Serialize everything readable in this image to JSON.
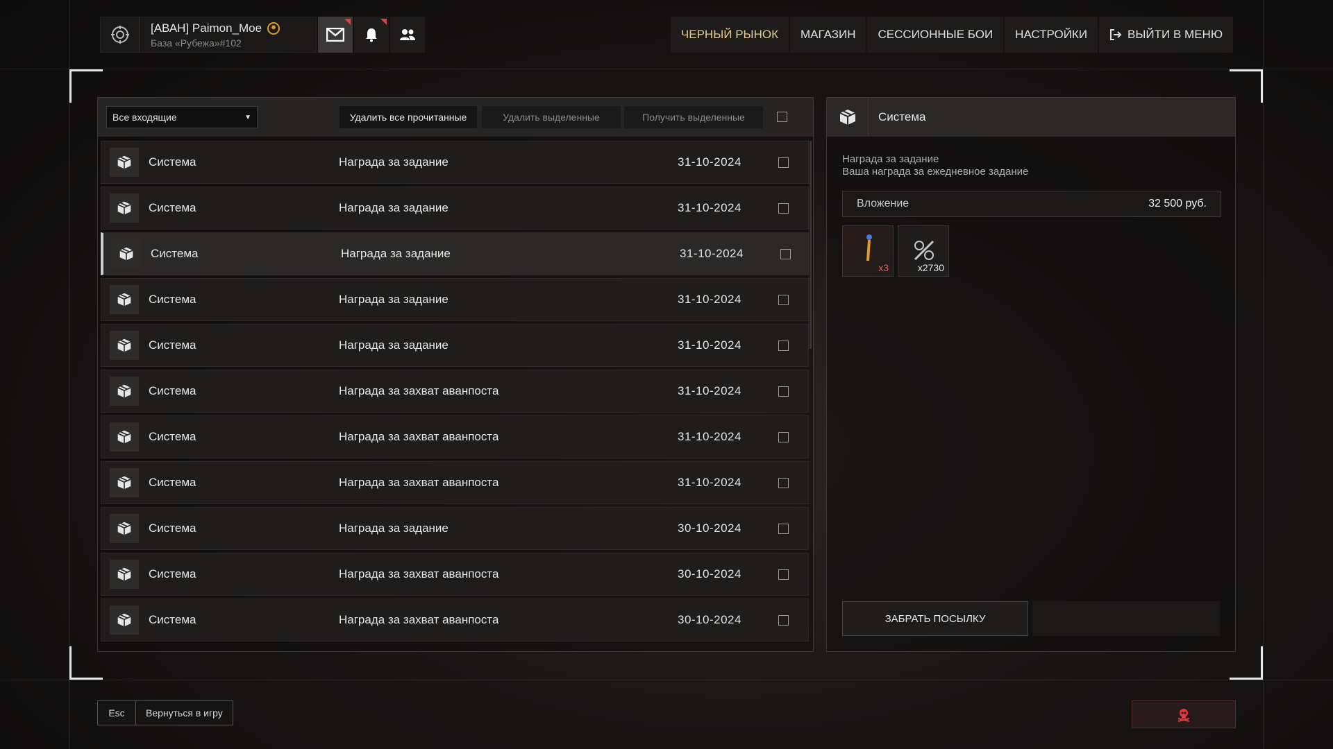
{
  "profile": {
    "name": "[АВАН] Paimon_Moe",
    "base": "База «Рубежа»#102"
  },
  "nav": [
    "ЧЕРНЫЙ РЫНОК",
    "МАГАЗИН",
    "СЕССИОННЫЕ БОИ",
    "НАСТРОЙКИ",
    "ВЫЙТИ В МЕНЮ"
  ],
  "toolbar": {
    "filter": "Все входящие",
    "delete_read": "Удалить все прочитанные",
    "delete_selected": "Удалить выделенные",
    "receive_selected": "Получить выделенные"
  },
  "messages": [
    {
      "sender": "Система",
      "subject": "Награда за задание",
      "date": "31-10-2024"
    },
    {
      "sender": "Система",
      "subject": "Награда за задание",
      "date": "31-10-2024"
    },
    {
      "sender": "Система",
      "subject": "Награда за задание",
      "date": "31-10-2024"
    },
    {
      "sender": "Система",
      "subject": "Награда за задание",
      "date": "31-10-2024"
    },
    {
      "sender": "Система",
      "subject": "Награда за задание",
      "date": "31-10-2024"
    },
    {
      "sender": "Система",
      "subject": "Награда за захват аванпоста",
      "date": "31-10-2024"
    },
    {
      "sender": "Система",
      "subject": "Награда за захват аванпоста",
      "date": "31-10-2024"
    },
    {
      "sender": "Система",
      "subject": "Награда за захват аванпоста",
      "date": "31-10-2024"
    },
    {
      "sender": "Система",
      "subject": "Награда за задание",
      "date": "30-10-2024"
    },
    {
      "sender": "Система",
      "subject": "Награда за захват аванпоста",
      "date": "30-10-2024"
    },
    {
      "sender": "Система",
      "subject": "Награда за захват аванпоста",
      "date": "30-10-2024"
    }
  ],
  "detail": {
    "sender": "Система",
    "title": "Награда за задание",
    "body": "Ваша награда за ежедневное задание",
    "attachment_label": "Вложение",
    "attachment_value": "32 500 руб.",
    "items": [
      {
        "qty": "x3"
      },
      {
        "qty": "x2730"
      }
    ],
    "claim": "ЗАБРАТЬ ПОСЫЛКУ"
  },
  "bottom": {
    "esc": "Esc",
    "back": "Вернуться в игру"
  },
  "colors": {
    "accent": "#e8c98e",
    "alert": "#d84545",
    "badge": "#d9a02a"
  }
}
